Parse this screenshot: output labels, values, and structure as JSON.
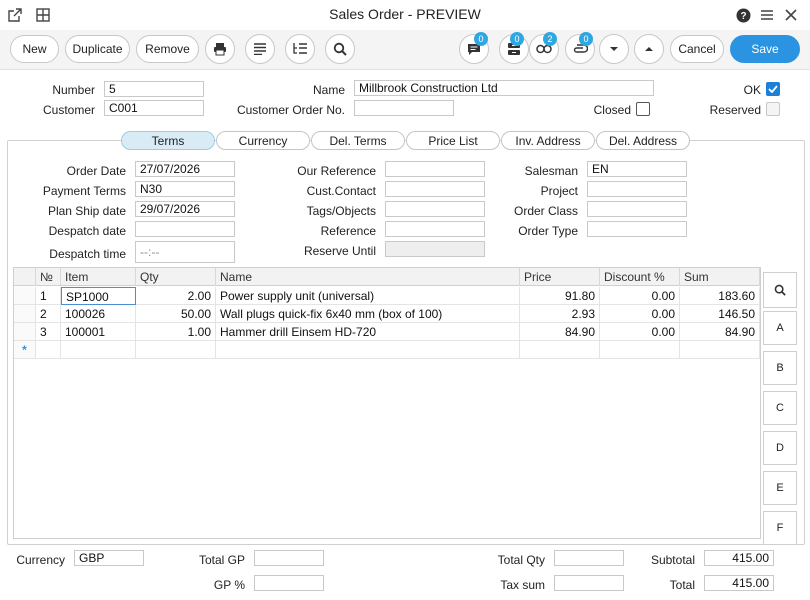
{
  "window": {
    "title": "Sales Order - PREVIEW"
  },
  "toolbar": {
    "new_label": "New",
    "duplicate_label": "Duplicate",
    "remove_label": "Remove",
    "cancel_label": "Cancel",
    "save_label": "Save",
    "badges": {
      "comments": "0",
      "inbox": "0",
      "links": "2",
      "attachments": "0"
    }
  },
  "header": {
    "number_label": "Number",
    "number_value": "5",
    "customer_label": "Customer",
    "customer_value": "C001",
    "name_label": "Name",
    "name_value": "Millbrook Construction Ltd",
    "cust_order_label": "Customer Order No.",
    "cust_order_value": "",
    "ok_label": "OK",
    "closed_label": "Closed",
    "reserved_label": "Reserved"
  },
  "tabs": [
    "Terms",
    "Currency",
    "Del. Terms",
    "Price List",
    "Inv. Address",
    "Del. Address"
  ],
  "terms": {
    "order_date_label": "Order Date",
    "order_date": "27/07/2026",
    "payment_terms_label": "Payment Terms",
    "payment_terms": "N30",
    "plan_ship_label": "Plan Ship date",
    "plan_ship": "29/07/2026",
    "despatch_date_label": "Despatch date",
    "despatch_date": "",
    "despatch_time_label": "Despatch time",
    "despatch_time": "--:--",
    "our_ref_label": "Our Reference",
    "our_ref": "",
    "cust_contact_label": "Cust.Contact",
    "cust_contact": "",
    "tags_label": "Tags/Objects",
    "tags": "",
    "reference_label": "Reference",
    "reference": "",
    "reserve_until_label": "Reserve Until",
    "reserve_until": "",
    "salesman_label": "Salesman",
    "salesman": "EN",
    "project_label": "Project",
    "project": "",
    "order_class_label": "Order Class",
    "order_class": "",
    "order_type_label": "Order Type",
    "order_type": ""
  },
  "grid": {
    "headers": {
      "no": "№",
      "item": "Item",
      "qty": "Qty",
      "name": "Name",
      "price": "Price",
      "discount": "Discount %",
      "sum": "Sum"
    },
    "rows": [
      {
        "no": "1",
        "item": "SP1000",
        "qty": "2.00",
        "name": "Power supply unit (universal)",
        "price": "91.80",
        "discount": "0.00",
        "sum": "183.60"
      },
      {
        "no": "2",
        "item": "100026",
        "qty": "50.00",
        "name": "Wall plugs quick-fix 6x40 mm (box of 100)",
        "price": "2.93",
        "discount": "0.00",
        "sum": "146.50"
      },
      {
        "no": "3",
        "item": "100001",
        "qty": "1.00",
        "name": "Hammer drill Einsem HD-720",
        "price": "84.90",
        "discount": "0.00",
        "sum": "84.90"
      }
    ],
    "new_row_marker": "*"
  },
  "side_buttons": [
    "A",
    "B",
    "C",
    "D",
    "E",
    "F"
  ],
  "footer": {
    "currency_label": "Currency",
    "currency": "GBP",
    "total_gp_label": "Total GP",
    "total_gp": "",
    "gp_pct_label": "GP %",
    "gp_pct": "",
    "total_qty_label": "Total Qty",
    "total_qty": "",
    "tax_sum_label": "Tax sum",
    "tax_sum": "",
    "subtotal_label": "Subtotal",
    "subtotal": "415.00",
    "total_label": "Total",
    "total": "415.00"
  }
}
